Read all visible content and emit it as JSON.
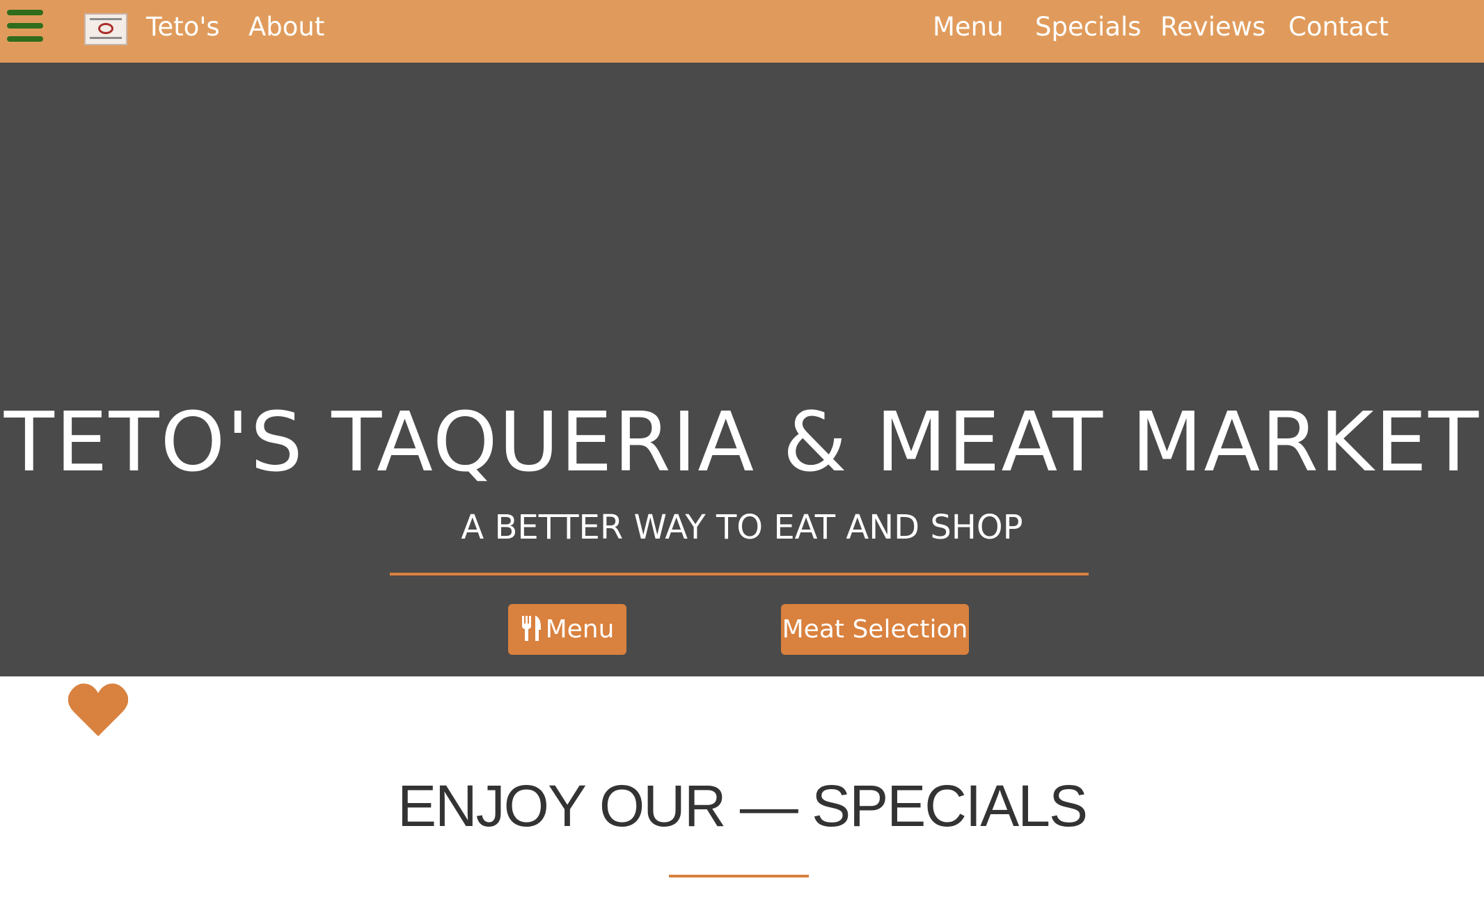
{
  "navbar": {
    "brand": "Teto's",
    "about": "About",
    "links": {
      "menu": "Menu",
      "specials": "Specials",
      "reviews": "Reviews",
      "contact": "Contact"
    }
  },
  "hero": {
    "title": "TETO'S TAQUERIA & MEAT MARKET",
    "subtitle": "A BETTER WAY TO EAT AND SHOP",
    "buttons": {
      "menu": "Menu",
      "meat_selection": "Meat Selection"
    }
  },
  "specials": {
    "heading": "ENJOY OUR  —  SPECIALS"
  },
  "icons": {
    "hamburger": "hamburger-menu-icon",
    "logo": "tetos-logo",
    "utensils": "utensils-icon",
    "heart": "heart-icon"
  },
  "colors": {
    "navbar_bg": "#e09b5c",
    "hero_bg": "#4a4a4a",
    "accent": "#d9813e",
    "hamburger": "#2f6d1c",
    "heading_text": "#333333"
  }
}
